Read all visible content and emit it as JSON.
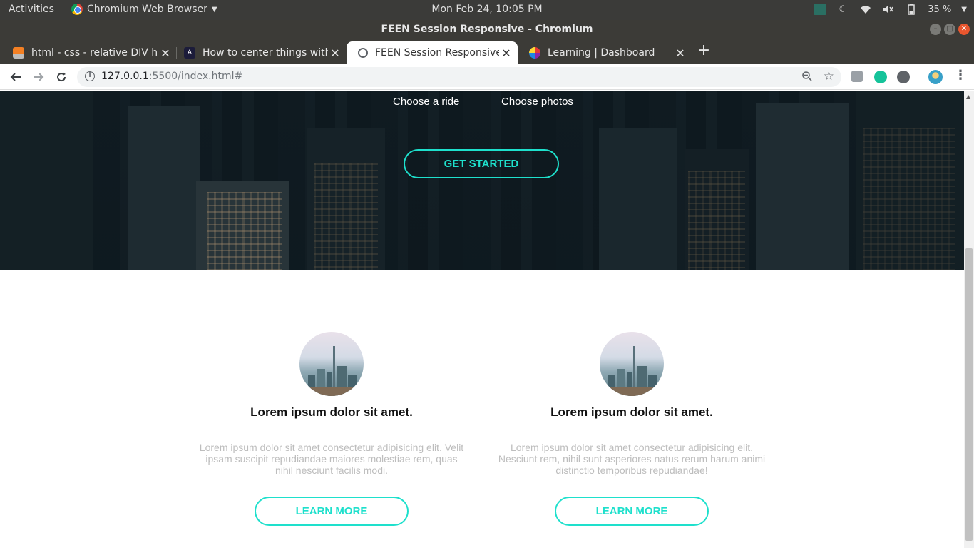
{
  "system": {
    "activities": "Activities",
    "app_name": "Chromium Web Browser",
    "clock": "Mon Feb 24, 10:05 PM",
    "battery": "35 %"
  },
  "window": {
    "title": "FEEN Session Responsive - Chromium"
  },
  "tabs": [
    {
      "title": "html - css - relative DIV ha",
      "favicon": "stackoverflow-icon"
    },
    {
      "title": "How to center things with",
      "favicon": "angular-icon"
    },
    {
      "title": "FEEN Session Responsive",
      "favicon": "globe-icon"
    },
    {
      "title": "Learning | Dashboard",
      "favicon": "learning-icon"
    }
  ],
  "address": {
    "host": "127.0.0.1",
    "path": ":5500/index.html#"
  },
  "hero": {
    "link_left": "Choose a ride",
    "link_right": "Choose photos",
    "cta": "GET STARTED"
  },
  "cards": [
    {
      "title": "Lorem ipsum dolor sit amet.",
      "body": "Lorem ipsum dolor sit amet consectetur adipisicing elit. Velit ipsam suscipit repudiandae maiores molestiae rem, quas nihil nesciunt facilis modi.",
      "button": "LEARN MORE"
    },
    {
      "title": "Lorem ipsum dolor sit amet.",
      "body": "Lorem ipsum dolor sit amet consectetur adipisicing elit. Nesciunt rem, nihil sunt asperiores natus rerum harum animi distinctio temporibus repudiandae!",
      "button": "LEARN MORE"
    }
  ],
  "colors": {
    "accent": "#1ee0cc",
    "chrome_dark": "#3c3b37"
  }
}
